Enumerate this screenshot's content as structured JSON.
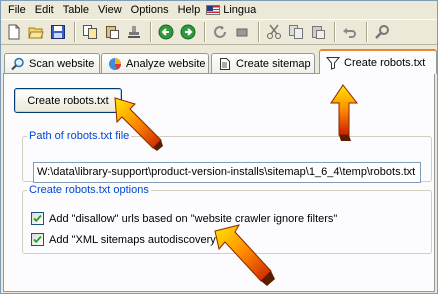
{
  "menu": [
    "File",
    "Edit",
    "Table",
    "View",
    "Options",
    "Help",
    "Lingua"
  ],
  "toolbar": {
    "icons": [
      "new-document-icon",
      "open-folder-icon",
      "save-icon",
      "copy-pages-icon",
      "paste-pages-icon",
      "stamp-icon",
      "back-arrow-icon",
      "forward-arrow-icon",
      "refresh-icon",
      "stop-icon",
      "cut-icon",
      "copy-icon",
      "paste-icon",
      "undo-icon",
      "search-icon"
    ]
  },
  "tabs": [
    {
      "label": "Scan website",
      "icon": "magnifier-icon"
    },
    {
      "label": "Analyze website",
      "icon": "pie-chart-icon"
    },
    {
      "label": "Create sitemap",
      "icon": "document-icon"
    },
    {
      "label": "Create robots.txt",
      "icon": "funnel-icon",
      "active": true
    }
  ],
  "panel": {
    "create_button": "Create robots.txt",
    "path_group": {
      "legend": "Path of robots.txt file",
      "value": "W:\\data\\library-support\\product-version-installs\\sitemap\\1_6_4\\temp\\robots.txt"
    },
    "options_group": {
      "legend": "Create robots.txt options",
      "options": [
        {
          "label": "Add \"disallow\" urls based on \"website crawler ignore filters\"",
          "checked": true
        },
        {
          "label": "Add \"XML sitemaps autodiscovery\"",
          "checked": true
        }
      ]
    }
  },
  "colors": {
    "accent_arrow": "#ff6a00",
    "legend_text": "#0046d5",
    "active_tab_border": "#e68b2c"
  }
}
